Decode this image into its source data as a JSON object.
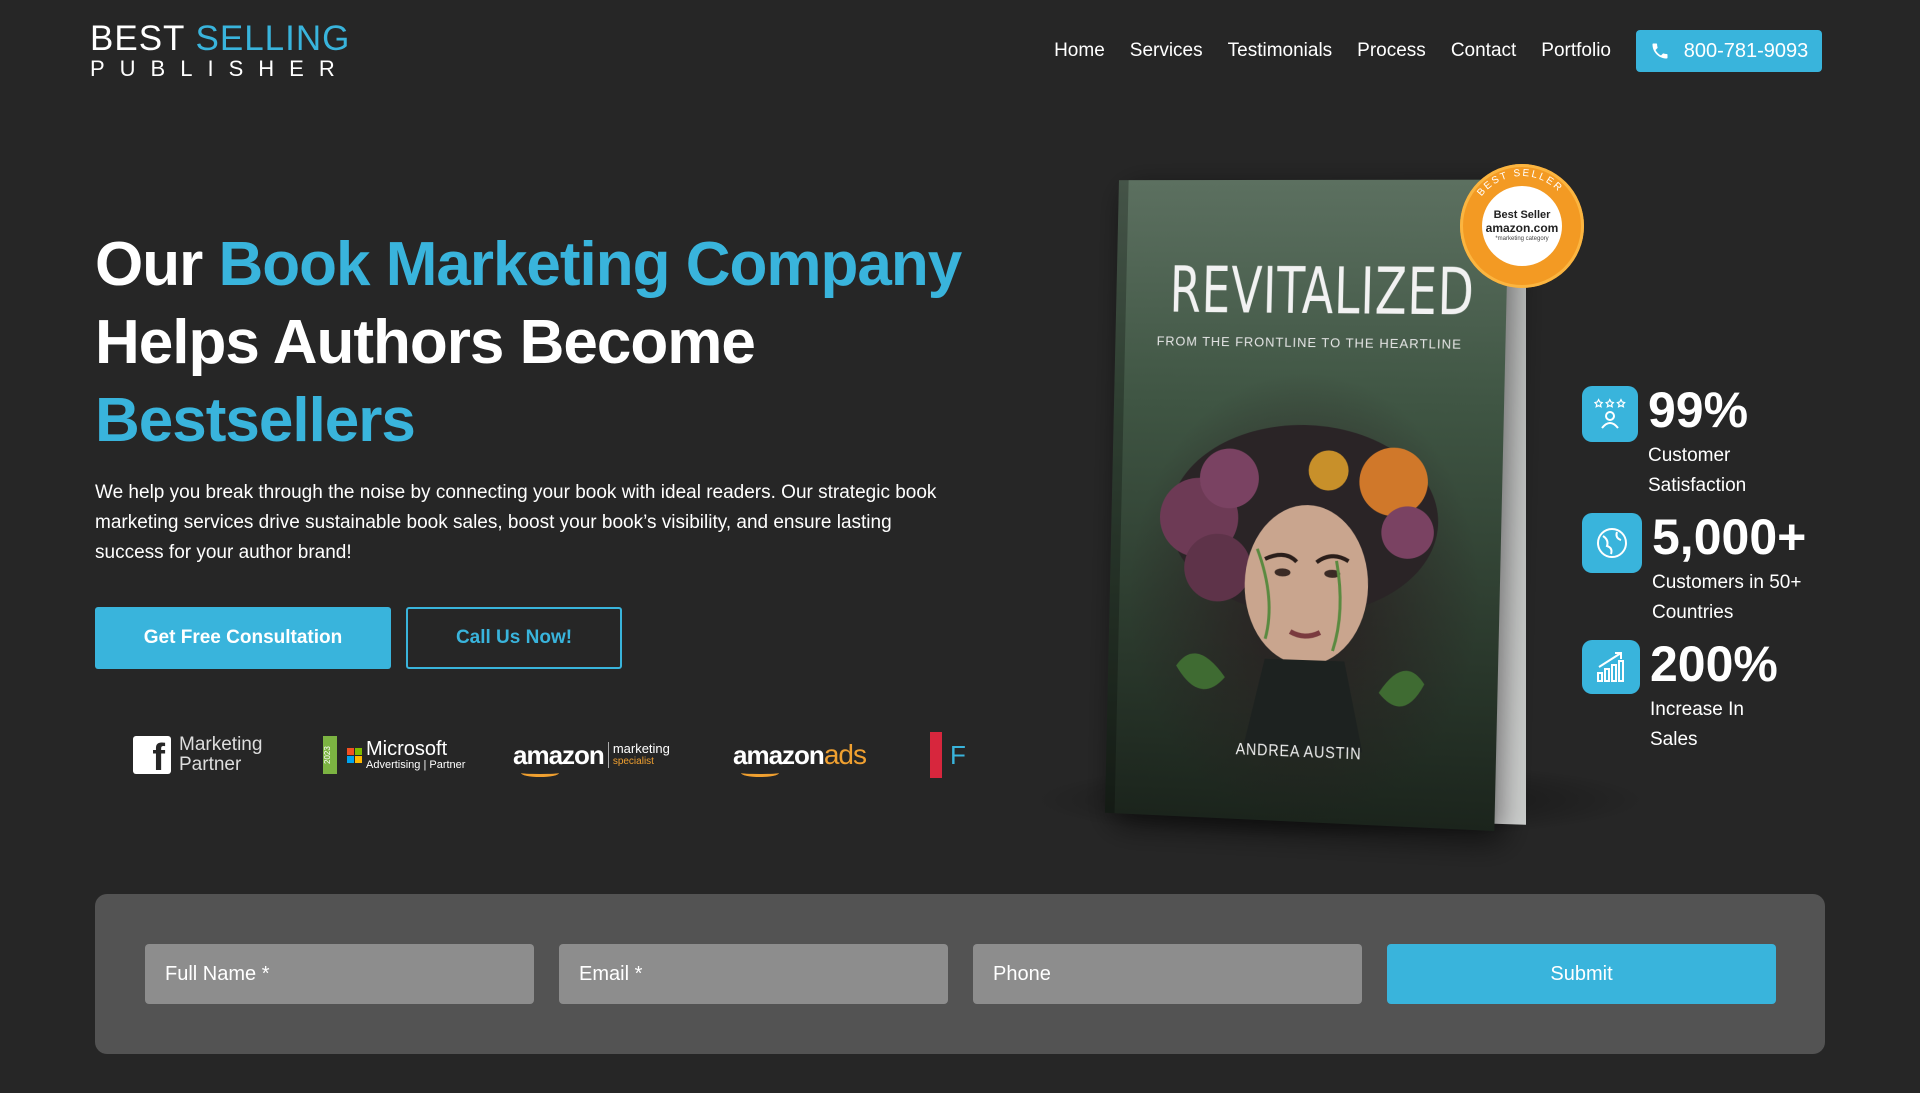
{
  "brand": {
    "line1_a": "BEST",
    "line1_b": "SELLING",
    "line2": "PUBLISHER"
  },
  "nav": {
    "items": [
      {
        "label": "Home"
      },
      {
        "label": "Services"
      },
      {
        "label": "Testimonials"
      },
      {
        "label": "Process"
      },
      {
        "label": "Contact"
      },
      {
        "label": "Portfolio"
      }
    ],
    "phone": "800-781-9093"
  },
  "hero": {
    "title_part1": "Our",
    "title_part2": "Book Marketing Company",
    "title_part3": "Helps Authors Become",
    "title_part4": "Bestsellers",
    "description": "We help you break through the noise by connecting your book with ideal readers. Our strategic book marketing services drive sustainable book sales, boost your book’s visibility, and ensure lasting success for your author brand!",
    "primary_cta": "Get Free Consultation",
    "secondary_cta": "Call Us Now!"
  },
  "partners": {
    "facebook_line1": "Marketing",
    "facebook_line2": "Partner",
    "microsoft_year": "2023",
    "microsoft_name": "Microsoft",
    "microsoft_sub": "Advertising | Partner",
    "amazon_marketing_word": "amazon",
    "amazon_marketing_line1": "marketing",
    "amazon_marketing_line2": "specialist",
    "amazon_ads_word": "amazon",
    "amazon_ads_suffix": "ads",
    "partial_mark": "F"
  },
  "book": {
    "title": "REVITALIZED",
    "subtitle": "FROM THE FRONTLINE TO THE HEARTLINE",
    "author": "ANDREA AUSTIN",
    "seal_line1": "Best Seller",
    "seal_line2": "amazon.com",
    "seal_line3": "*marketing category",
    "seal_ring": "BEST SELLER"
  },
  "stats": [
    {
      "value": "99%",
      "label": "Customer Satisfaction"
    },
    {
      "value": "5,000+",
      "label": "Customers in 50+ Countries"
    },
    {
      "value": "200%",
      "label": "Increase In Sales"
    }
  ],
  "form": {
    "name_placeholder": "Full Name *",
    "email_placeholder": "Email *",
    "phone_placeholder": "Phone",
    "submit_label": "Submit"
  },
  "colors": {
    "accent": "#39b4dc",
    "background": "#262626",
    "form_panel": "#535353",
    "amazon_orange": "#f0a030"
  }
}
